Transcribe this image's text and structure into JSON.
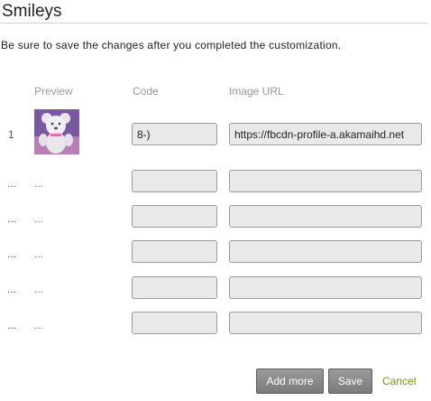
{
  "page": {
    "title": "Smileys",
    "description": "Be sure to save the changes after you completed the customization."
  },
  "table": {
    "headers": {
      "preview": "Preview",
      "code": "Code",
      "image_url": "Image URL"
    },
    "rows": [
      {
        "num": "1",
        "preview": "teddy-bear-image",
        "code": "8-)",
        "url": "https://fbcdn-profile-a.akamaihd.net"
      },
      {
        "num": "...",
        "preview": "...",
        "code": "",
        "url": ""
      },
      {
        "num": "...",
        "preview": "...",
        "code": "",
        "url": ""
      },
      {
        "num": "...",
        "preview": "...",
        "code": "",
        "url": ""
      },
      {
        "num": "...",
        "preview": "...",
        "code": "",
        "url": ""
      },
      {
        "num": "...",
        "preview": "...",
        "code": "",
        "url": ""
      }
    ]
  },
  "actions": {
    "add_more": "Add more",
    "save": "Save",
    "cancel": "Cancel"
  },
  "colors": {
    "button_bg": "#8a8a8a",
    "cancel_link": "#6a9a1a",
    "field_bg": "#e9e9e9"
  }
}
